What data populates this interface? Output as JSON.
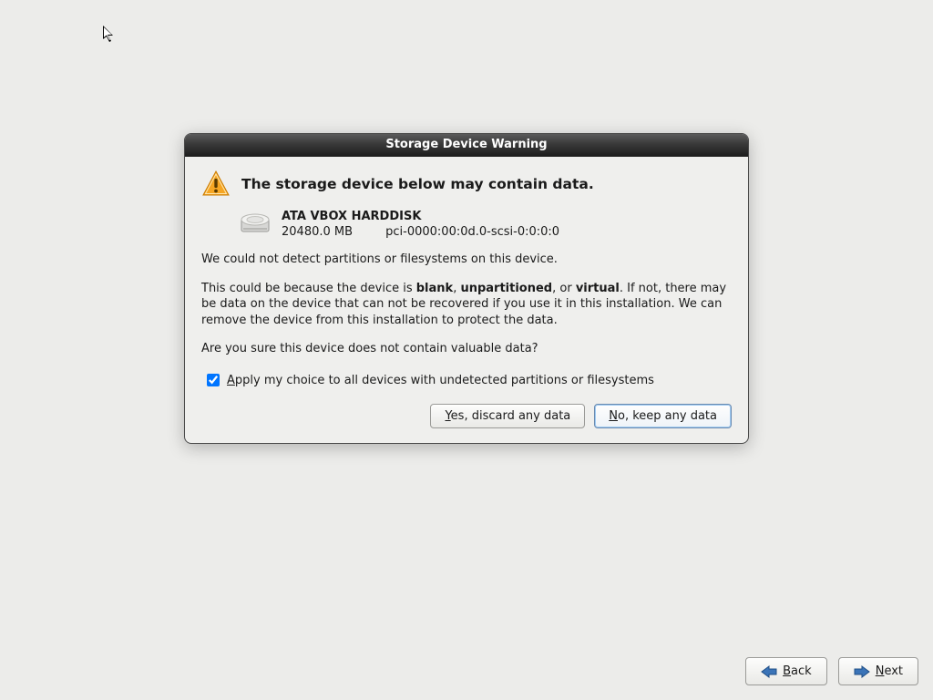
{
  "dialog": {
    "title": "Storage Device Warning",
    "headline": "The storage device below may contain data.",
    "device": {
      "name": "ATA VBOX HARDDISK",
      "size": "20480.0 MB",
      "path": "pci-0000:00:0d.0-scsi-0:0:0:0"
    },
    "para1": "We could not detect partitions or filesystems on this device.",
    "para2_a": "This could be because the device is ",
    "para2_b1": "blank",
    "para2_c": ", ",
    "para2_b2": "unpartitioned",
    "para2_d": ", or ",
    "para2_b3": "virtual",
    "para2_e": ". If not, there may be data on the device that can not be recovered if you use it in this installation. We can remove the device from this installation to protect the data.",
    "para3": "Are you sure this device does not contain valuable data?",
    "checkbox_label_pre": "A",
    "checkbox_label_post": "pply my choice to all devices with undetected partitions or filesystems",
    "btn_yes_u": "Y",
    "btn_yes_rest": "es, discard any data",
    "btn_no_u": "N",
    "btn_no_rest": "o, keep any data"
  },
  "nav": {
    "back_u": "B",
    "back_rest": "ack",
    "next_u": "N",
    "next_rest": "ext"
  }
}
